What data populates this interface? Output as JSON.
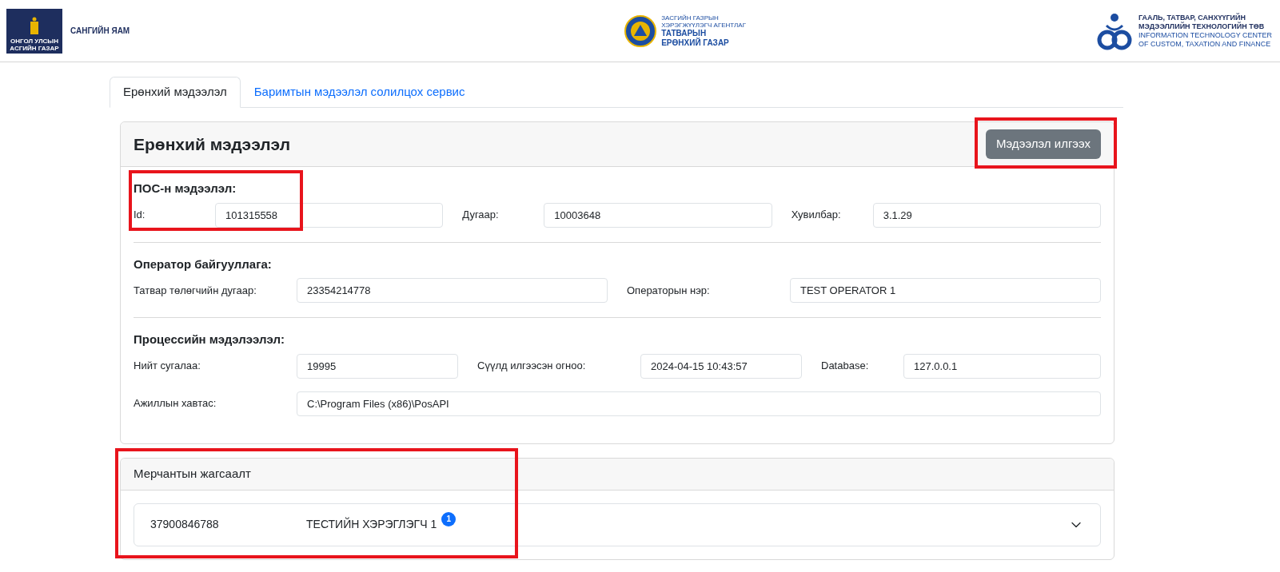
{
  "header": {
    "left_logo": {
      "emblem_lines": [
        "ОНГОЛ УЛСЫН",
        "АСГИЙН ГАЗАР"
      ],
      "name": "САНГИЙН ЯАМ"
    },
    "center_logo": {
      "lines": [
        "ЗАСГИЙН ГАЗРЫН",
        "ХЭРЭГЖҮҮЛЭГЧ АГЕНТЛАГ"
      ],
      "name_lines": [
        "ТАТВАРЫН",
        "ЕРӨНХИЙ ГАЗАР"
      ]
    },
    "right_logo": {
      "name_lines": [
        "ГААЛЬ, ТАТВАР, САНХҮҮГИЙН",
        "МЭДЭЭЛЛИЙН ТЕХНОЛОГИЙН ТӨВ"
      ],
      "english_lines": [
        "INFORMATION TECHNOLOGY CENTER",
        "OF CUSTOM, TAXATION AND FINANCE"
      ]
    }
  },
  "tabs": [
    {
      "label": "Ерөнхий мэдээлэл",
      "selected": true
    },
    {
      "label": "Баримтын мэдээлэл солилцох сервис",
      "selected": false
    }
  ],
  "general_card": {
    "title": "Ерөнхий мэдээлэл",
    "send_button": {
      "label": "Мэдээлэл илгээх",
      "highlighted": true
    },
    "sections": [
      {
        "title": "ПОС-н мэдээлэл:",
        "highlighted": true,
        "rows": [
          [
            {
              "label": "Id:",
              "value": "101315558"
            },
            {
              "label": "Дугаар:",
              "value": "10003648"
            },
            {
              "label": "Хувилбар:",
              "value": "3.1.29"
            }
          ]
        ]
      },
      {
        "title": "Оператор байгууллага:",
        "highlighted": false,
        "rows": [
          [
            {
              "label": "Татвар төлөгчийн дугаар:",
              "value": "23354214778"
            },
            {
              "label": "Операторын нэр:",
              "value": "TEST OPERATOR 1"
            }
          ]
        ]
      },
      {
        "title": "Процессийн мэдэлээлэл:",
        "highlighted": false,
        "rows": [
          [
            {
              "label": "Нийт сугалаа:",
              "value": "19995"
            },
            {
              "label": "Сүүлд илгээсэн огноо:",
              "value": "2024-04-15 10:43:57"
            },
            {
              "label": "Database:",
              "value": "127.0.0.1"
            }
          ],
          [
            {
              "label": "Ажиллын хавтас:",
              "value": "C:\\Program Files (x86)\\PosAPI"
            }
          ]
        ]
      }
    ]
  },
  "merchant_card": {
    "title": "Мерчантын жагсаалт",
    "highlighted": true,
    "items": [
      {
        "tin": "37900846788",
        "name": "ТЕСТИЙН ХЭРЭГЛЭГЧ 1",
        "badge": "1",
        "expanded": false
      }
    ]
  }
}
